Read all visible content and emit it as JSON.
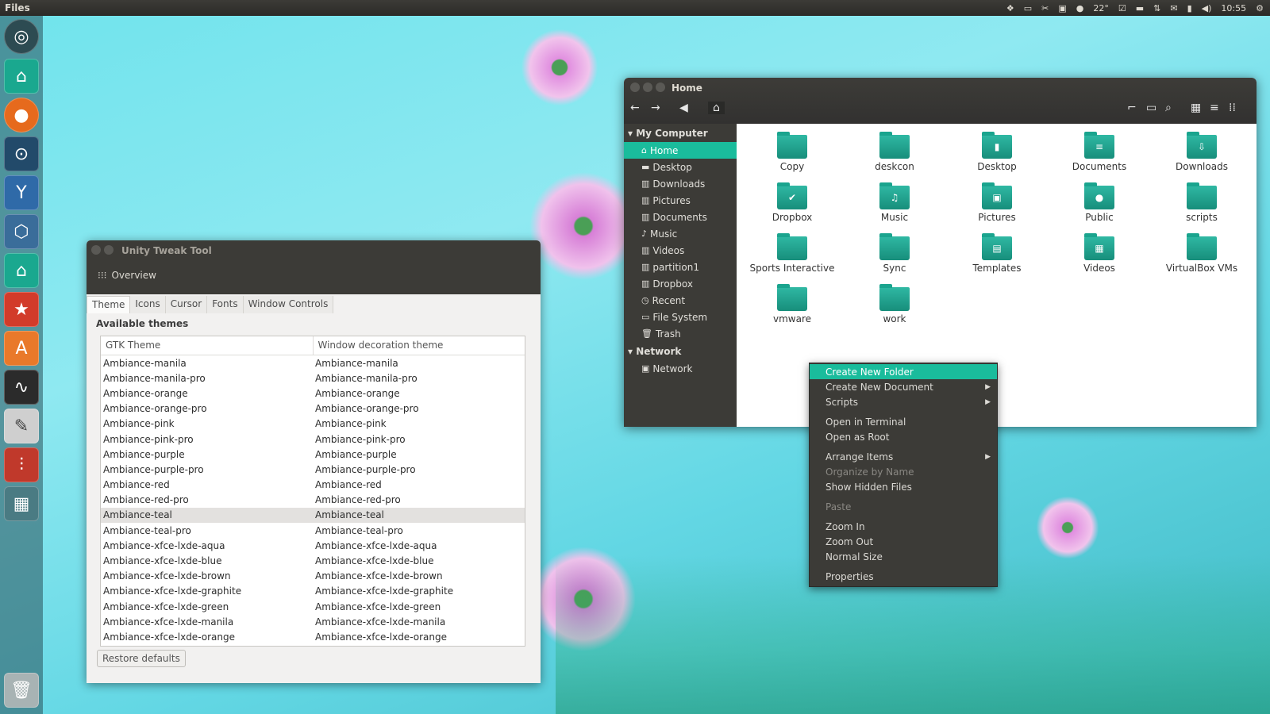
{
  "topbar": {
    "app_title": "Files",
    "weather": "22°",
    "clock": "10:55"
  },
  "launcher": {
    "items": [
      "ubuntu-logo-icon",
      "home-folder-icon",
      "firefox-icon",
      "steam-icon",
      "y-ppa-manager-icon",
      "virtualbox-icon",
      "files-icon",
      "software-updater-icon",
      "software-center-icon",
      "system-monitor-icon",
      "text-editor-icon",
      "unity-tweak-tool-icon",
      "workspace-switcher-icon",
      "trash-icon"
    ]
  },
  "tweak": {
    "title": "Unity Tweak Tool",
    "overview": "Overview",
    "tabs": [
      "Theme",
      "Icons",
      "Cursor",
      "Fonts",
      "Window Controls"
    ],
    "available_label": "Available themes",
    "col_gtk": "GTK Theme",
    "col_wdt": "Window decoration theme",
    "rows": [
      "Ambiance-manila",
      "Ambiance-manila-pro",
      "Ambiance-orange",
      "Ambiance-orange-pro",
      "Ambiance-pink",
      "Ambiance-pink-pro",
      "Ambiance-purple",
      "Ambiance-purple-pro",
      "Ambiance-red",
      "Ambiance-red-pro",
      "Ambiance-teal",
      "Ambiance-teal-pro",
      "Ambiance-xfce-lxde-aqua",
      "Ambiance-xfce-lxde-blue",
      "Ambiance-xfce-lxde-brown",
      "Ambiance-xfce-lxde-graphite",
      "Ambiance-xfce-lxde-green",
      "Ambiance-xfce-lxde-manila",
      "Ambiance-xfce-lxde-orange"
    ],
    "selected": "Ambiance-teal",
    "restore": "Restore defaults"
  },
  "fm": {
    "title": "Home",
    "sidebar": {
      "computer_header": "My Computer",
      "items": [
        "Home",
        "Desktop",
        "Downloads",
        "Pictures",
        "Documents",
        "Music",
        "Videos",
        "partition1",
        "Dropbox",
        "Recent",
        "File System",
        "Trash"
      ],
      "network_header": "Network",
      "network_items": [
        "Network"
      ]
    },
    "files": [
      "Copy",
      "deskcon",
      "Desktop",
      "Documents",
      "Downloads",
      "Dropbox",
      "Music",
      "Pictures",
      "Public",
      "scripts",
      "Sports Interactive",
      "Sync",
      "Templates",
      "Videos",
      "VirtualBox VMs",
      "vmware",
      "work"
    ]
  },
  "menu": {
    "items": [
      "Create New Folder",
      "Create New Document",
      "Scripts",
      "Open in Terminal",
      "Open as Root",
      "Arrange Items",
      "Organize by Name",
      "Show Hidden Files",
      "Paste",
      "Zoom In",
      "Zoom Out",
      "Normal Size",
      "Properties"
    ]
  },
  "colors": {
    "accent": "#1abc9c",
    "panel": "#3c3b37"
  }
}
